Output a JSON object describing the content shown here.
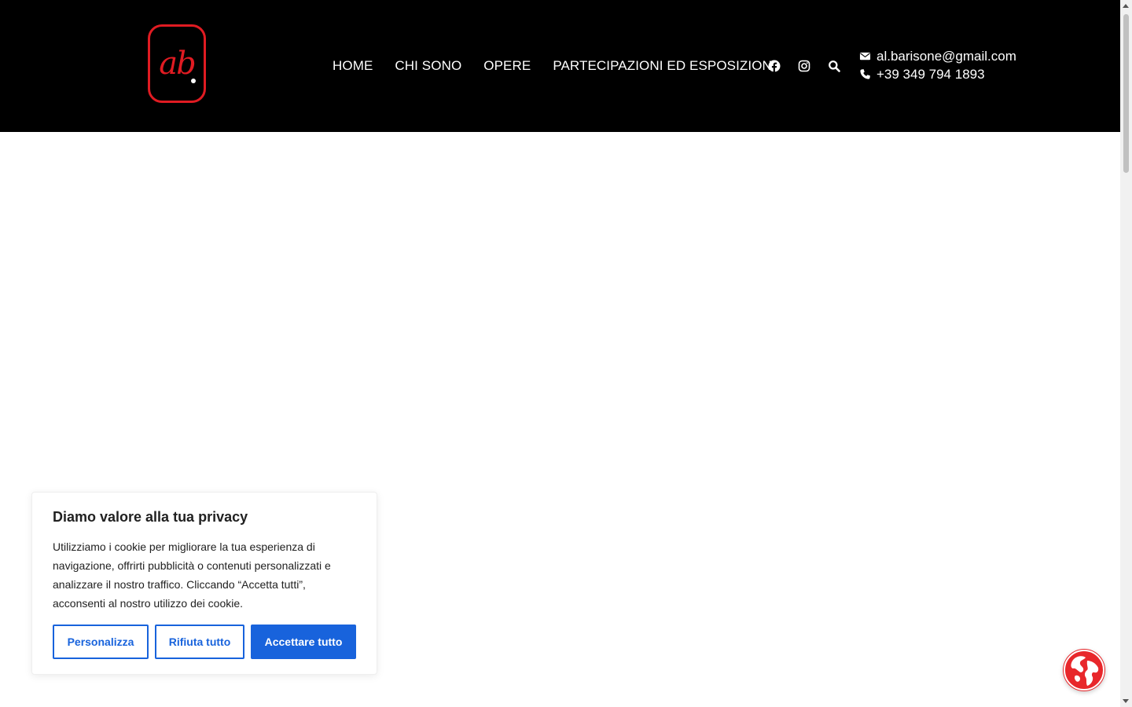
{
  "header": {
    "logo_text": "ab",
    "nav": [
      {
        "label": "HOME"
      },
      {
        "label": "CHI SONO"
      },
      {
        "label": "OPERE"
      },
      {
        "label": "PARTECIPAZIONI ED ESPOSIZIONI"
      }
    ],
    "icons": [
      "facebook-icon",
      "instagram-icon",
      "search-icon"
    ],
    "email": "al.barisone@gmail.com",
    "phone": "+39 349 794 1893"
  },
  "cookie_banner": {
    "title": "Diamo valore alla tua privacy",
    "text": "Utilizziamo i cookie per migliorare la tua esperienza di navigazione, offrirti pubblicità o contenuti personalizzati e analizzare il nostro traffico. Cliccando “Accetta tutti”, acconsenti al nostro utilizzo dei cookie.",
    "customize_label": "Personalizza",
    "reject_label": "Rifiuta tutto",
    "accept_label": "Accettare tutto"
  },
  "colors": {
    "brand_red": "#e01b22",
    "accent_blue": "#1863dc",
    "header_bg": "#000000"
  }
}
